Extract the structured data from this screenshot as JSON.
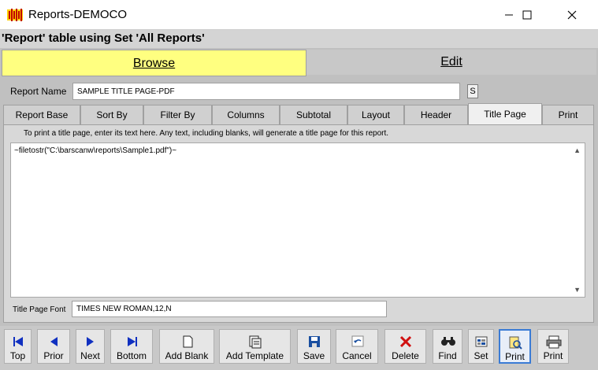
{
  "window": {
    "title": "Reports-DEMOCO"
  },
  "caption": "'Report' table using Set 'All Reports'",
  "modes": {
    "browse": "Browse",
    "edit": "Edit"
  },
  "report_name": {
    "label": "Report Name",
    "value": "SAMPLE TITLE PAGE-PDF",
    "s_button": "S"
  },
  "tabs": [
    "Report Base",
    "Sort By",
    "Filter By",
    "Columns",
    "Subtotal",
    "Layout",
    "Header",
    "Title Page",
    "Print"
  ],
  "active_tab": "Title Page",
  "title_page": {
    "instruction": "To print a title page, enter its text here. Any text, including blanks, will generate a title page for this report.",
    "text": "~filetostr(\"C:\\barscanw\\reports\\Sample1.pdf\")~",
    "font_label": "Title Page Font",
    "font_value": "TIMES NEW ROMAN,12,N"
  },
  "toolbar": {
    "top": "Top",
    "prior": "Prior",
    "next": "Next",
    "bottom": "Bottom",
    "add_blank": "Add Blank",
    "add_template": "Add Template",
    "save": "Save",
    "cancel": "Cancel",
    "delete": "Delete",
    "find": "Find",
    "set": "Set",
    "print_preview": "Print",
    "print": "Print"
  },
  "colors": {
    "browse_tab": "#ffff80",
    "panel": "#c0c0c0",
    "accent": "#3a7bd5"
  }
}
